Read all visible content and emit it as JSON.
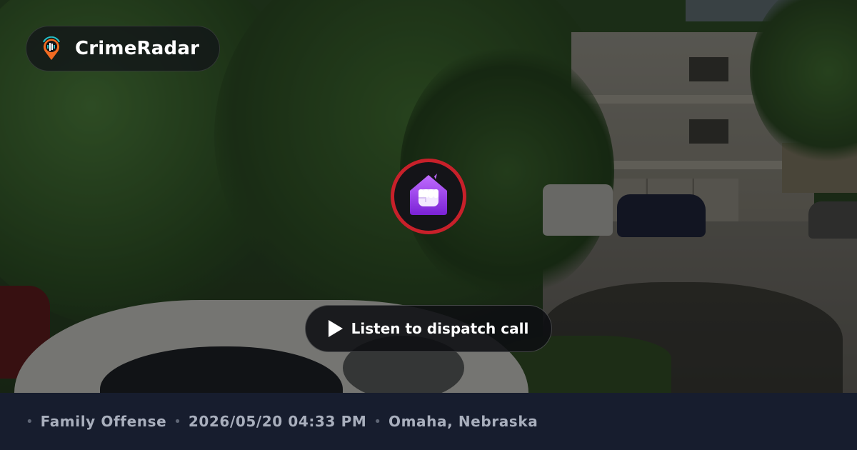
{
  "brand": {
    "name": "CrimeRadar",
    "logo_icon": "location-pin-radar-icon",
    "logo_colors": {
      "pin": "#f26b21",
      "waves": "#25c0c9"
    }
  },
  "crime_icon": {
    "name": "fist-house-icon",
    "ring_color": "#c8202a",
    "fill_color": "#9b3df0"
  },
  "listen_button": {
    "label": "Listen to dispatch call",
    "icon": "play-icon"
  },
  "info": {
    "separator": "•",
    "category": "Family Offense",
    "datetime": "2026/05/20 04:33 PM",
    "location": "Omaha, Nebraska"
  }
}
